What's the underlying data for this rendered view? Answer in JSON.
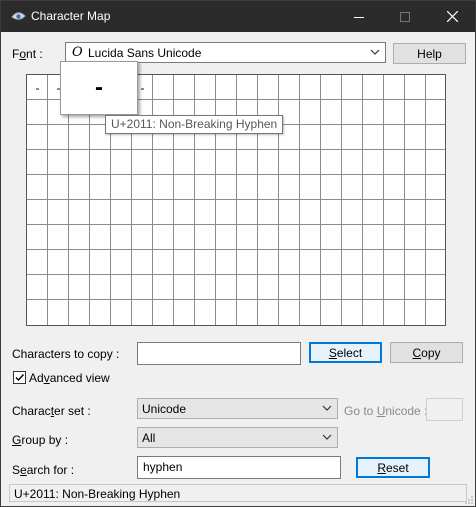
{
  "window": {
    "title": "Character Map",
    "icon": "character-map-app-icon",
    "controls": [
      "minimize-icon",
      "maximize-icon",
      "close-icon"
    ]
  },
  "font": {
    "label_pre": "F",
    "label_u": "o",
    "label_post": "nt :",
    "value": "Lucida Sans Unicode",
    "font_icon": "O",
    "help_label": "Help"
  },
  "grid": {
    "characters": [
      "‑",
      "‑",
      "‑",
      "‑",
      "‑",
      "-"
    ],
    "zoomed_character": "‑",
    "tooltip": "U+2011: Non-Breaking Hyphen"
  },
  "copy": {
    "label": "Characters to copy :",
    "value": "",
    "select_pre": "",
    "select_u": "S",
    "select_post": "elect",
    "copy_pre": "",
    "copy_u": "C",
    "copy_post": "opy"
  },
  "advanced": {
    "checked": true,
    "label_pre": "Ad",
    "label_u": "v",
    "label_post": "anced view"
  },
  "charset": {
    "label_pre": "Charac",
    "label_u": "t",
    "label_post": "er set :",
    "value": "Unicode",
    "goto_pre": "Go to ",
    "goto_u": "U",
    "goto_post": "nicode :",
    "goto_value": ""
  },
  "groupby": {
    "label_pre": "",
    "label_u": "G",
    "label_post": "roup by :",
    "value": "All"
  },
  "search": {
    "label_pre": "S",
    "label_u": "e",
    "label_post": "arch for :",
    "value": "hyphen",
    "reset_pre": "",
    "reset_u": "R",
    "reset_post": "eset"
  },
  "status": {
    "text": "U+2011: Non-Breaking Hyphen"
  },
  "colors": {
    "titlebar": "#2b2b2b",
    "accent": "#0078d7"
  }
}
